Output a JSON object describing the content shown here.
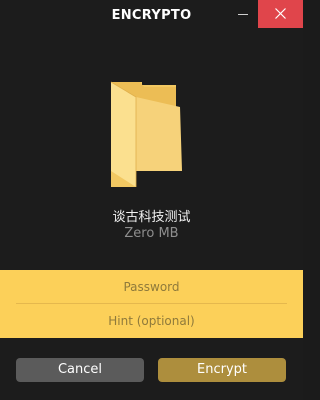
{
  "window": {
    "title": "ENCRYPTO"
  },
  "titlebar": {
    "minimize_icon": "minimize-icon",
    "close_icon": "close-icon",
    "close_color": "#e0454b"
  },
  "file": {
    "icon": "folder-icon",
    "name": "谈古科技测试",
    "size": "Zero MB"
  },
  "form": {
    "background": "#fcd059",
    "password_placeholder": "Password",
    "password_value": "",
    "hint_placeholder": "Hint (optional)",
    "hint_value": ""
  },
  "actions": {
    "cancel_label": "Cancel",
    "encrypt_label": "Encrypt",
    "encrypt_color": "#ad8e3d"
  }
}
